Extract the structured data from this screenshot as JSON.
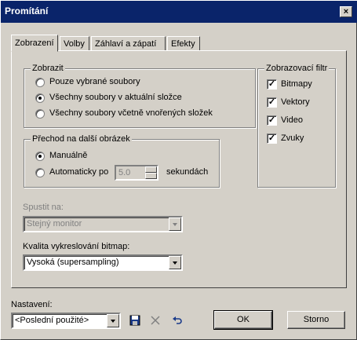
{
  "window": {
    "title": "Promítání",
    "close_glyph": "×"
  },
  "tabs": [
    {
      "label": "Zobrazení",
      "active": true
    },
    {
      "label": "Volby",
      "active": false
    },
    {
      "label": "Záhlaví a zápatí",
      "active": false
    },
    {
      "label": "Efekty",
      "active": false
    }
  ],
  "zobrazit": {
    "legend": "Zobrazit",
    "options": [
      {
        "label": "Pouze vybrané soubory",
        "checked": false
      },
      {
        "label": "Všechny soubory v aktuální složce",
        "checked": true
      },
      {
        "label": "Všechny soubory včetně vnořených složek",
        "checked": false
      }
    ]
  },
  "filter": {
    "legend": "Zobrazovací filtr",
    "items": [
      {
        "label": "Bitmapy",
        "checked": true
      },
      {
        "label": "Vektory",
        "checked": true
      },
      {
        "label": "Video",
        "checked": true
      },
      {
        "label": "Zvuky",
        "checked": true
      }
    ]
  },
  "transition": {
    "legend": "Přechod na další obrázek",
    "manual_label": "Manuálně",
    "auto_label": "Automaticky po",
    "seconds_value": "5.0",
    "seconds_unit": "sekundách"
  },
  "launch": {
    "label": "Spustit na:",
    "value": "Stejný monitor"
  },
  "quality": {
    "label": "Kvalita vykreslování bitmap:",
    "value": "Vysoká (supersampling)"
  },
  "settings": {
    "label": "Nastavení:",
    "value": "<Poslední použité>"
  },
  "buttons": {
    "ok": "OK",
    "cancel": "Storno"
  },
  "icons": {
    "save": "save-icon",
    "delete": "delete-icon",
    "undo": "undo-icon",
    "dropdown": "chevron-down-icon"
  }
}
